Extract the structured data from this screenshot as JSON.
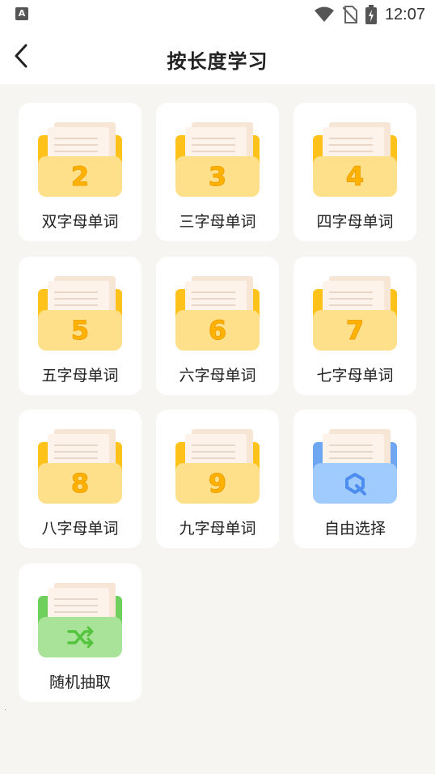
{
  "status_bar": {
    "left_icon": "a-notification-icon",
    "time": "12:07",
    "icons": [
      "wifi-icon",
      "no-sim-icon",
      "battery-charging-icon"
    ]
  },
  "header": {
    "back_icon": "chevron-left-icon",
    "title": "按长度学习"
  },
  "cards": [
    {
      "label": "双字母单词",
      "badge": "2",
      "theme": "yellow"
    },
    {
      "label": "三字母单词",
      "badge": "3",
      "theme": "yellow"
    },
    {
      "label": "四字母单词",
      "badge": "4",
      "theme": "yellow"
    },
    {
      "label": "五字母单词",
      "badge": "5",
      "theme": "yellow"
    },
    {
      "label": "六字母单词",
      "badge": "6",
      "theme": "yellow"
    },
    {
      "label": "七字母单词",
      "badge": "7",
      "theme": "yellow"
    },
    {
      "label": "八字母单词",
      "badge": "8",
      "theme": "yellow"
    },
    {
      "label": "九字母单词",
      "badge": "9",
      "theme": "yellow"
    },
    {
      "label": "自由选择",
      "icon": "refresh-select-icon",
      "theme": "blue"
    },
    {
      "label": "随机抽取",
      "icon": "shuffle-icon",
      "theme": "green"
    }
  ],
  "colors": {
    "yellow_front": "#ffe08a",
    "yellow_side": "#ffc21a",
    "yellow_number": "#ffb300",
    "blue_front": "#9fcbff",
    "blue_side": "#6fa6f2",
    "blue_icon": "#4d8df0",
    "green_front": "#a9e39a",
    "green_side": "#6fcf5c",
    "green_icon": "#54c43e",
    "paper": "#fdf3ea",
    "paper_line": "#e8d7c8"
  }
}
